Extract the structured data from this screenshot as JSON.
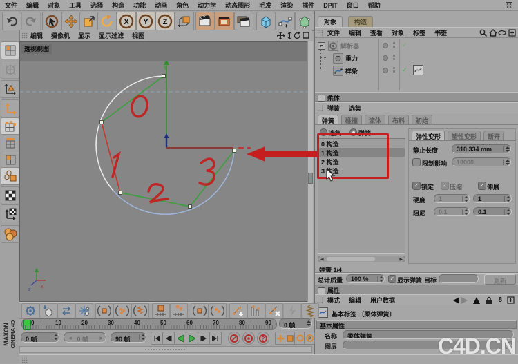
{
  "menubar": {
    "items": [
      "文件",
      "编辑",
      "对象",
      "工具",
      "选择",
      "构造",
      "功能",
      "动画",
      "角色",
      "动力学",
      "动态图形",
      "毛发",
      "渲染",
      "插件",
      "DPIT",
      "窗口",
      "帮助"
    ]
  },
  "toolbar": {
    "icons": [
      "undo",
      "redo",
      "live-selection",
      "move",
      "scale",
      "rotate",
      "lock-x",
      "lock-y",
      "lock-z",
      "coordinate-system",
      "render-view",
      "render-active-view",
      "render-settings",
      "primitive-cube",
      "spline-pen",
      "generator-cube"
    ],
    "x_label": "X",
    "y_label": "Y",
    "z_label": "Z"
  },
  "left_toolbar": {
    "icons": [
      "make-editable",
      "world-grid",
      "model-mode",
      "object-axis-mode",
      "point-mode",
      "edge-mode",
      "polygon-mode",
      "use-object-axis",
      "texture-mode",
      "texture-axis-mode",
      "selection-filter"
    ]
  },
  "viewport": {
    "menu": [
      "编辑",
      "摄像机",
      "显示",
      "显示过滤",
      "视图"
    ],
    "label": "透视视图",
    "icons": [
      "pan-icon",
      "zoom-icon",
      "rotate-view-icon",
      "maximize-icon"
    ],
    "axis_y_label": "Y"
  },
  "object_manager": {
    "tabs": [
      "对象",
      "构造"
    ],
    "menu": [
      "文件",
      "编辑",
      "查看",
      "对象",
      "标签",
      "书签"
    ],
    "icons": [
      "search-icon",
      "home-icon",
      "eye-icon",
      "add-layer-icon"
    ],
    "tree": [
      {
        "label": "解析器"
      },
      {
        "label": "重力"
      },
      {
        "label": "样条"
      }
    ]
  },
  "softbody": {
    "title": "柔体",
    "menu": [
      "弹簧",
      "选集"
    ],
    "tabs": [
      "弹簧",
      "碰撞",
      "流体",
      "布料",
      "初始"
    ],
    "radios": [
      "选集",
      "弹簧"
    ],
    "springs": [
      "0 构造",
      "1 构造",
      "2 构造",
      "3 构造"
    ],
    "deform_tabs": [
      "弹性变形",
      "塑性变形",
      "断开"
    ],
    "rest_length_label": "静止长度",
    "rest_length": "310.334 mm",
    "limit_label": "限制影响",
    "limit": "10000",
    "lock_label": "锁定",
    "compress_label": "压缩",
    "stretch_label": "伸展",
    "stiffness_label": "硬度",
    "stiffness1": "1",
    "stiffness2": "1",
    "damping_label": "阻尼",
    "damping1": "0.1",
    "damping2": "0.1",
    "pager": "弹簧 1/4",
    "mass_label": "总计质量",
    "mass": "100 %",
    "show_springs_label": "显示弹簧",
    "target_label": "目标",
    "update_label": "更新"
  },
  "attributes": {
    "title": "属性",
    "menu": [
      "模式",
      "编辑",
      "用户数据"
    ],
    "icons": [
      "back-arrow-icon",
      "forward-arrow-icon",
      "up-arrow-icon",
      "lock-icon",
      "history-icon",
      "add-icon"
    ],
    "history_glyph": "8",
    "tag_label": "基本标签 〔柔体弹簧〕",
    "section": "基本属性",
    "name_label": "名称",
    "name_value": "柔体弹簧",
    "layer_label": "图层",
    "layer_value": ""
  },
  "anim_toolbar": {
    "icons": [
      "solver-gear",
      "drop-cube",
      "swap-arrows",
      "snowflake",
      "bracket-cube",
      "bracket-balls",
      "bracket-spring",
      "cube-keyline",
      "balls-keyline",
      "bracket-cube-2",
      "bracket-balls-2",
      "graph-add",
      "graph-clamp",
      "graph-delete",
      "lightning",
      "spring-edge"
    ]
  },
  "timeline": {
    "ticks": [
      "0",
      "10",
      "20",
      "30",
      "40",
      "50",
      "60",
      "70",
      "80",
      "90"
    ],
    "current": "0 帧",
    "start": "0 帧",
    "slider": "0 帧",
    "end": "90 帧",
    "transport_icons": [
      "goto-start-icon",
      "prev-key-icon",
      "play-backwards-icon",
      "play-icon",
      "next-key-icon",
      "goto-end-icon"
    ],
    "record_icons": [
      "record-keyframe-icon",
      "autokey-icon",
      "keyframe-selection-icon"
    ],
    "key_icons": [
      "key-position-icon",
      "key-scale-icon",
      "key-rotation-icon",
      "key-parameter-icon",
      "key-pla-icon",
      "key-dots-icon",
      "keyframe-sheet-icon"
    ]
  },
  "annotations": {
    "n0": "0",
    "n1": "1",
    "n2": "2",
    "n3": "3"
  },
  "branding": {
    "app_line1": "MAXON",
    "app_line2": "CINEMA 4D",
    "watermark": "C4D.CN"
  },
  "colors": {
    "accent_orange": "#dd8a3c",
    "spring_green": "#3f9e3f",
    "annotation_red": "#c41e1e",
    "arc_white": "#e9e9e9",
    "arc_blue": "#9db6d8",
    "playhead_green": "#35c93f"
  }
}
